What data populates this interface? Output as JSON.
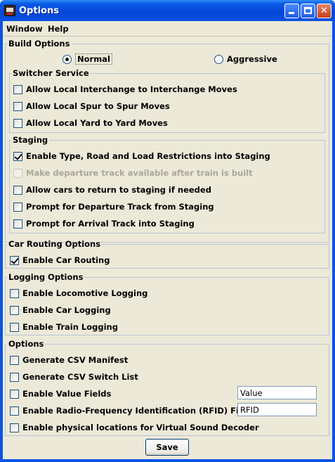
{
  "window": {
    "title": "Options",
    "icon": "train-icon",
    "controls": [
      "minimize-icon",
      "maximize-icon",
      "close-icon"
    ]
  },
  "menu": [
    "Window",
    "Help"
  ],
  "build_options": {
    "legend": "Build Options",
    "radios": [
      {
        "label": "Normal",
        "selected": true
      },
      {
        "label": "Aggressive",
        "selected": false
      }
    ]
  },
  "switcher_service": {
    "legend": "Switcher Service",
    "items": [
      {
        "label": "Allow Local Interchange to Interchange Moves",
        "checked": false
      },
      {
        "label": "Allow Local Spur to Spur Moves",
        "checked": false
      },
      {
        "label": "Allow Local Yard to Yard Moves",
        "checked": false
      }
    ]
  },
  "staging": {
    "legend": "Staging",
    "items": [
      {
        "label": "Enable Type, Road and Load Restrictions into Staging",
        "checked": true,
        "enabled": true
      },
      {
        "label": "Make departure track available after train is built",
        "checked": false,
        "enabled": false
      },
      {
        "label": "Allow cars to return to staging if needed",
        "checked": false,
        "enabled": true
      },
      {
        "label": "Prompt for Departure Track from Staging",
        "checked": false,
        "enabled": true
      },
      {
        "label": "Prompt for Arrival Track into Staging",
        "checked": false,
        "enabled": true
      }
    ]
  },
  "car_routing": {
    "legend": "Car Routing Options",
    "items": [
      {
        "label": "Enable Car Routing",
        "checked": true
      }
    ]
  },
  "logging": {
    "legend": "Logging Options",
    "items": [
      {
        "label": "Enable Locomotive Logging",
        "checked": false
      },
      {
        "label": "Enable Car Logging",
        "checked": false
      },
      {
        "label": "Enable Train Logging",
        "checked": false
      }
    ]
  },
  "options": {
    "legend": "Options",
    "items": [
      {
        "label": "Generate CSV Manifest",
        "checked": false
      },
      {
        "label": "Generate CSV Switch List",
        "checked": false
      },
      {
        "label": "Enable Value Fields",
        "checked": false
      },
      {
        "label": "Enable Radio-Frequency Identification (RFID) Fields",
        "checked": false
      },
      {
        "label": "Enable physical locations for Virtual Sound Decoder",
        "checked": false
      }
    ],
    "value_field": "Value",
    "rfid_field": "RFID"
  },
  "save_label": "Save"
}
